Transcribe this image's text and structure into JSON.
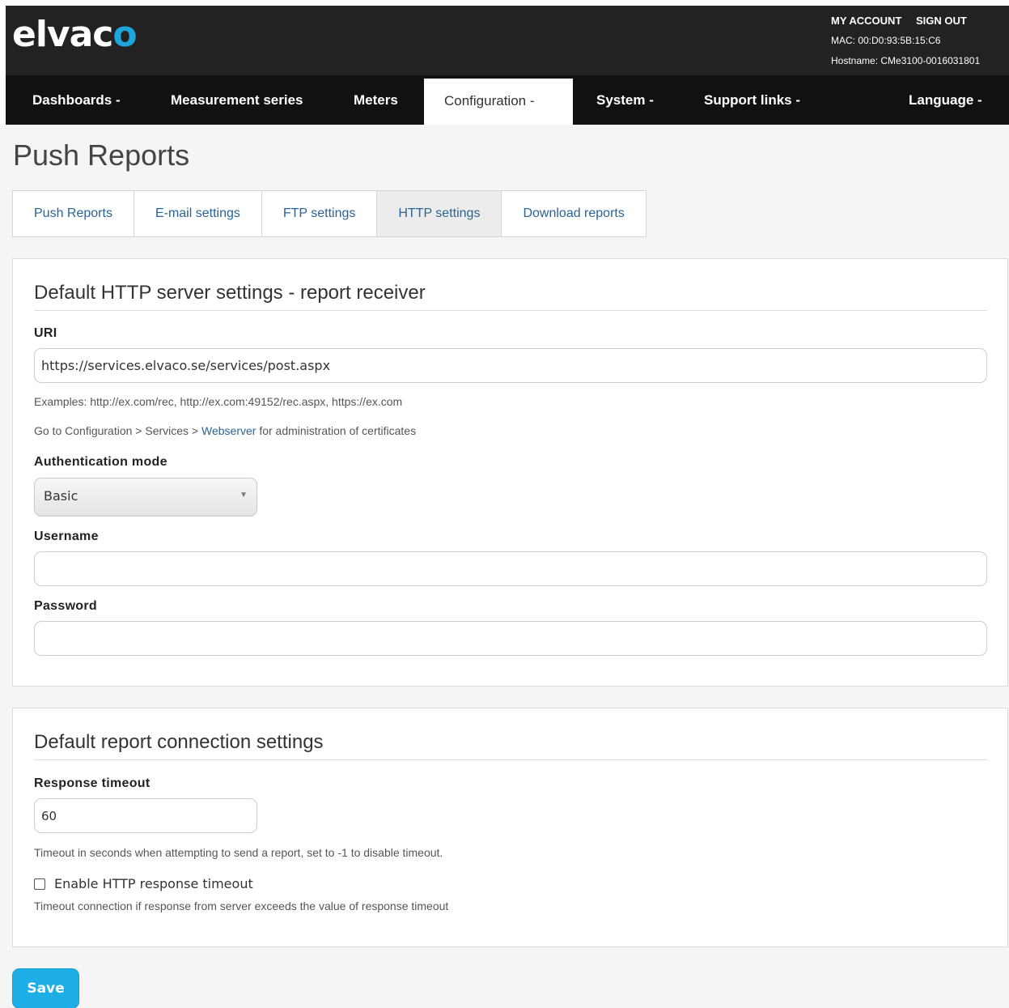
{
  "header": {
    "logo_text": "elvac",
    "logo_accent": "o",
    "my_account": "MY ACCOUNT",
    "sign_out": "SIGN OUT",
    "mac": "MAC: 00:D0:93:5B:15:C6",
    "hostname": "Hostname: CMe3100-0016031801"
  },
  "nav": {
    "dashboards": "Dashboards -",
    "measurement_series": "Measurement series",
    "meters": "Meters",
    "configuration": "Configuration -",
    "system": "System -",
    "support_links": "Support links -",
    "language": "Language -"
  },
  "page": {
    "title": "Push Reports"
  },
  "tabs": [
    {
      "label": "Push Reports"
    },
    {
      "label": "E-mail settings"
    },
    {
      "label": "FTP settings"
    },
    {
      "label": "HTTP settings",
      "active": true
    },
    {
      "label": "Download reports"
    }
  ],
  "http_panel": {
    "title": "Default HTTP server settings - report receiver",
    "uri_label": "URI",
    "uri_value": "https://services.elvaco.se/services/post.aspx",
    "examples": "Examples: http://ex.com/rec, http://ex.com:49152/rec.aspx, https://ex.com",
    "goto_prefix": "Go to Configuration > Services > ",
    "goto_link": "Webserver",
    "goto_suffix": " for administration of certificates",
    "auth_label": "Authentication mode",
    "auth_value": "Basic",
    "username_label": "Username",
    "username_value": "",
    "password_label": "Password",
    "password_value": ""
  },
  "connection_panel": {
    "title": "Default report connection settings",
    "timeout_label": "Response timeout",
    "timeout_value": "60",
    "timeout_help": "Timeout in seconds when attempting to send a report, set to -1 to disable timeout.",
    "enable_label": "Enable HTTP response timeout",
    "enable_checked": false,
    "enable_help": "Timeout connection if response from server exceeds the value of response timeout"
  },
  "actions": {
    "save_label": "Save"
  },
  "colors": {
    "accent": "#1eaee6",
    "header_bg": "#222222",
    "nav_bg": "#111111",
    "link": "#2a6496"
  }
}
